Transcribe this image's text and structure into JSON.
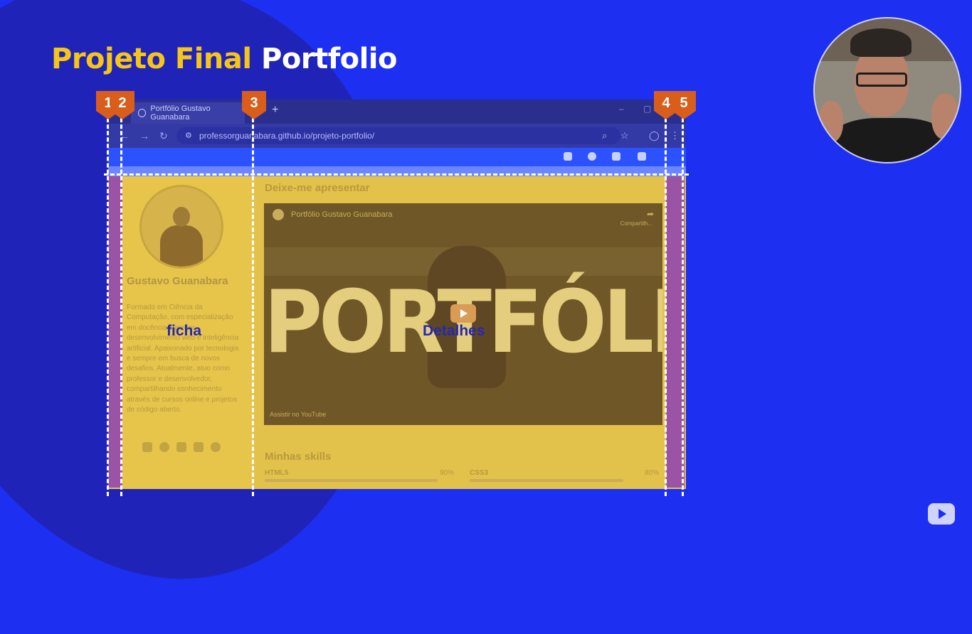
{
  "slide": {
    "title_part1": "Projeto Final",
    "title_part2": "Portfolio"
  },
  "browser": {
    "tab_title": "Portfólio Gustavo Guanabara",
    "new_tab": "+",
    "address": "professorguanabara.github.io/projeto-portfolio/"
  },
  "portfolio": {
    "name": "Gustavo Guanabara",
    "bio": "Formado em Ciência da Computação, com especialização em docência superior, desenvolvimento web e inteligência artificial. Apaixonado por tecnologia e sempre em busca de novos desafios. Atualmente, atuo como professor e desenvolvedor, compartilhando conhecimento através de cursos online e projetos de código aberto.",
    "section_intro": "Deixe-me apresentar",
    "section_skills": "Minhas skills",
    "video": {
      "channel_title": "Portfólio Gustavo Guanabara",
      "share": "Compartilh...",
      "big_text": "PORTFÓLIO",
      "watch_on": "Assistir no YouTube"
    },
    "skills": [
      {
        "name": "HTML5",
        "percent": "90%",
        "level": 0.9
      },
      {
        "name": "CSS3",
        "percent": "80%",
        "level": 0.8
      }
    ]
  },
  "annotations": {
    "markers": [
      "1",
      "2",
      "3",
      "4",
      "5"
    ],
    "label_left": "ficha",
    "label_right": "Detalhes",
    "colors": {
      "marker": "#d95d1b",
      "overlay_yellow": "#e2c24a",
      "overlay_purple": "#9b53a6",
      "label": "#2528b4"
    }
  },
  "icons": [
    "home-icon",
    "info-icon",
    "graduation-icon",
    "settings-icon",
    "search-icon",
    "star-icon",
    "profile-icon",
    "play-icon",
    "linkedin-icon",
    "github-icon",
    "youtube-icon",
    "instagram-icon",
    "globe-icon"
  ]
}
